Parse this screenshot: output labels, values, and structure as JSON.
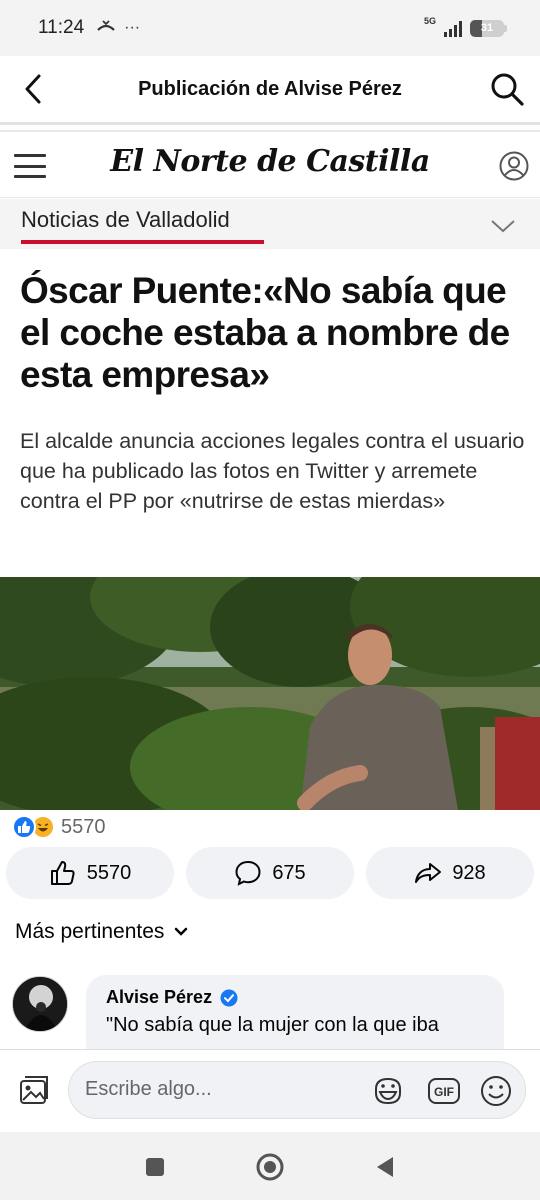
{
  "status_bar": {
    "time": "11:24",
    "extra_icons": "···",
    "network": "5G",
    "battery": "31"
  },
  "header": {
    "title": "Publicación de Alvise Pérez"
  },
  "article": {
    "newspaper": "El Norte de Castilla",
    "section": "Noticias de Valladolid",
    "headline": "Óscar Puente:«No sabía que el coche estaba a nombre de esta empresa»",
    "subheadline": "El alcalde anuncia acciones legales contra el usuario que ha publicado las fotos en Twitter y arremete contra el PP por «nutrirse de estas mierdas»"
  },
  "reactions": {
    "count": "5570",
    "icons": [
      "like-icon",
      "haha-icon"
    ]
  },
  "actions": {
    "like_count": "5570",
    "comment_count": "675",
    "share_count": "928"
  },
  "comments": {
    "sort_label": "Más pertinentes",
    "items": [
      {
        "author": "Alvise Pérez",
        "verified": true,
        "text": "\"No sabía que la mujer con la que iba"
      }
    ]
  },
  "composer": {
    "placeholder": "Escribe algo..."
  },
  "colors": {
    "accent_blue": "#1877f2",
    "section_red": "#c8102e",
    "haha_yellow": "#f7b125",
    "button_gray": "#f0f2f5"
  }
}
